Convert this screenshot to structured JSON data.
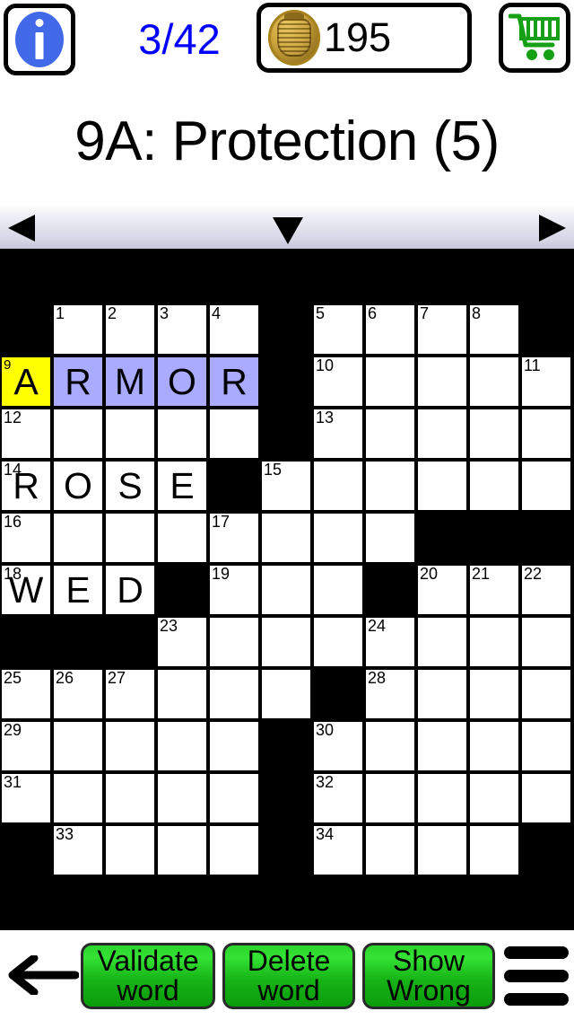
{
  "topbar": {
    "info_icon": "info-icon",
    "progress": "3/42",
    "coin_icon": "gold-coin-icon",
    "coin_count": "195",
    "cart_icon": "shopping-cart-icon"
  },
  "clue": {
    "text": "9A: Protection (5)"
  },
  "navstrip": {
    "prev_icon": "triangle-left-icon",
    "direction_icon": "triangle-down-icon",
    "next_icon": "triangle-right-icon"
  },
  "grid": {
    "columns": 11,
    "rows": 12,
    "cell_size": 58,
    "colors": {
      "block": "#000000",
      "empty": "#ffffff",
      "active_word": "#aaaaff",
      "cursor": "#ffff00"
    },
    "cells": [
      {
        "r": 1,
        "c": 1,
        "num": "1",
        "letter": ""
      },
      {
        "r": 1,
        "c": 2,
        "num": "2",
        "letter": ""
      },
      {
        "r": 1,
        "c": 3,
        "num": "3",
        "letter": ""
      },
      {
        "r": 1,
        "c": 4,
        "num": "4",
        "letter": ""
      },
      {
        "r": 1,
        "c": 6,
        "num": "5",
        "letter": ""
      },
      {
        "r": 1,
        "c": 7,
        "num": "6",
        "letter": ""
      },
      {
        "r": 1,
        "c": 8,
        "num": "7",
        "letter": ""
      },
      {
        "r": 1,
        "c": 9,
        "num": "8",
        "letter": ""
      },
      {
        "r": 2,
        "c": 0,
        "num": "9",
        "letter": "A",
        "state": "cursor"
      },
      {
        "r": 2,
        "c": 1,
        "num": "",
        "letter": "R",
        "state": "active"
      },
      {
        "r": 2,
        "c": 2,
        "num": "",
        "letter": "M",
        "state": "active"
      },
      {
        "r": 2,
        "c": 3,
        "num": "",
        "letter": "O",
        "state": "active"
      },
      {
        "r": 2,
        "c": 4,
        "num": "",
        "letter": "R",
        "state": "active"
      },
      {
        "r": 2,
        "c": 6,
        "num": "10",
        "letter": ""
      },
      {
        "r": 2,
        "c": 7,
        "num": "",
        "letter": ""
      },
      {
        "r": 2,
        "c": 8,
        "num": "",
        "letter": ""
      },
      {
        "r": 2,
        "c": 9,
        "num": "",
        "letter": ""
      },
      {
        "r": 2,
        "c": 10,
        "num": "11",
        "letter": ""
      },
      {
        "r": 3,
        "c": 0,
        "num": "12",
        "letter": ""
      },
      {
        "r": 3,
        "c": 1,
        "num": "",
        "letter": ""
      },
      {
        "r": 3,
        "c": 2,
        "num": "",
        "letter": ""
      },
      {
        "r": 3,
        "c": 3,
        "num": "",
        "letter": ""
      },
      {
        "r": 3,
        "c": 4,
        "num": "",
        "letter": ""
      },
      {
        "r": 3,
        "c": 6,
        "num": "13",
        "letter": ""
      },
      {
        "r": 3,
        "c": 7,
        "num": "",
        "letter": ""
      },
      {
        "r": 3,
        "c": 8,
        "num": "",
        "letter": ""
      },
      {
        "r": 3,
        "c": 9,
        "num": "",
        "letter": ""
      },
      {
        "r": 3,
        "c": 10,
        "num": "",
        "letter": ""
      },
      {
        "r": 4,
        "c": 0,
        "num": "14",
        "letter": "R"
      },
      {
        "r": 4,
        "c": 1,
        "num": "",
        "letter": "O"
      },
      {
        "r": 4,
        "c": 2,
        "num": "",
        "letter": "S"
      },
      {
        "r": 4,
        "c": 3,
        "num": "",
        "letter": "E"
      },
      {
        "r": 4,
        "c": 5,
        "num": "15",
        "letter": ""
      },
      {
        "r": 4,
        "c": 6,
        "num": "",
        "letter": ""
      },
      {
        "r": 4,
        "c": 7,
        "num": "",
        "letter": ""
      },
      {
        "r": 4,
        "c": 8,
        "num": "",
        "letter": ""
      },
      {
        "r": 4,
        "c": 9,
        "num": "",
        "letter": ""
      },
      {
        "r": 4,
        "c": 10,
        "num": "",
        "letter": ""
      },
      {
        "r": 5,
        "c": 0,
        "num": "16",
        "letter": ""
      },
      {
        "r": 5,
        "c": 1,
        "num": "",
        "letter": ""
      },
      {
        "r": 5,
        "c": 2,
        "num": "",
        "letter": ""
      },
      {
        "r": 5,
        "c": 3,
        "num": "",
        "letter": ""
      },
      {
        "r": 5,
        "c": 4,
        "num": "17",
        "letter": ""
      },
      {
        "r": 5,
        "c": 5,
        "num": "",
        "letter": ""
      },
      {
        "r": 5,
        "c": 6,
        "num": "",
        "letter": ""
      },
      {
        "r": 5,
        "c": 7,
        "num": "",
        "letter": ""
      },
      {
        "r": 6,
        "c": 0,
        "num": "18",
        "letter": "W"
      },
      {
        "r": 6,
        "c": 1,
        "num": "",
        "letter": "E"
      },
      {
        "r": 6,
        "c": 2,
        "num": "",
        "letter": "D"
      },
      {
        "r": 6,
        "c": 4,
        "num": "19",
        "letter": ""
      },
      {
        "r": 6,
        "c": 5,
        "num": "",
        "letter": ""
      },
      {
        "r": 6,
        "c": 6,
        "num": "",
        "letter": ""
      },
      {
        "r": 6,
        "c": 8,
        "num": "20",
        "letter": ""
      },
      {
        "r": 6,
        "c": 9,
        "num": "21",
        "letter": ""
      },
      {
        "r": 6,
        "c": 10,
        "num": "22",
        "letter": ""
      },
      {
        "r": 7,
        "c": 3,
        "num": "23",
        "letter": ""
      },
      {
        "r": 7,
        "c": 4,
        "num": "",
        "letter": ""
      },
      {
        "r": 7,
        "c": 5,
        "num": "",
        "letter": ""
      },
      {
        "r": 7,
        "c": 6,
        "num": "",
        "letter": ""
      },
      {
        "r": 7,
        "c": 7,
        "num": "24",
        "letter": ""
      },
      {
        "r": 7,
        "c": 8,
        "num": "",
        "letter": ""
      },
      {
        "r": 7,
        "c": 9,
        "num": "",
        "letter": ""
      },
      {
        "r": 7,
        "c": 10,
        "num": "",
        "letter": ""
      },
      {
        "r": 8,
        "c": 0,
        "num": "25",
        "letter": ""
      },
      {
        "r": 8,
        "c": 1,
        "num": "26",
        "letter": ""
      },
      {
        "r": 8,
        "c": 2,
        "num": "27",
        "letter": ""
      },
      {
        "r": 8,
        "c": 3,
        "num": "",
        "letter": ""
      },
      {
        "r": 8,
        "c": 4,
        "num": "",
        "letter": ""
      },
      {
        "r": 8,
        "c": 5,
        "num": "",
        "letter": ""
      },
      {
        "r": 8,
        "c": 7,
        "num": "28",
        "letter": ""
      },
      {
        "r": 8,
        "c": 8,
        "num": "",
        "letter": ""
      },
      {
        "r": 8,
        "c": 9,
        "num": "",
        "letter": ""
      },
      {
        "r": 8,
        "c": 10,
        "num": "",
        "letter": ""
      },
      {
        "r": 9,
        "c": 0,
        "num": "29",
        "letter": ""
      },
      {
        "r": 9,
        "c": 1,
        "num": "",
        "letter": ""
      },
      {
        "r": 9,
        "c": 2,
        "num": "",
        "letter": ""
      },
      {
        "r": 9,
        "c": 3,
        "num": "",
        "letter": ""
      },
      {
        "r": 9,
        "c": 4,
        "num": "",
        "letter": ""
      },
      {
        "r": 9,
        "c": 6,
        "num": "30",
        "letter": ""
      },
      {
        "r": 9,
        "c": 7,
        "num": "",
        "letter": ""
      },
      {
        "r": 9,
        "c": 8,
        "num": "",
        "letter": ""
      },
      {
        "r": 9,
        "c": 9,
        "num": "",
        "letter": ""
      },
      {
        "r": 9,
        "c": 10,
        "num": "",
        "letter": ""
      },
      {
        "r": 10,
        "c": 0,
        "num": "31",
        "letter": ""
      },
      {
        "r": 10,
        "c": 1,
        "num": "",
        "letter": ""
      },
      {
        "r": 10,
        "c": 2,
        "num": "",
        "letter": ""
      },
      {
        "r": 10,
        "c": 3,
        "num": "",
        "letter": ""
      },
      {
        "r": 10,
        "c": 4,
        "num": "",
        "letter": ""
      },
      {
        "r": 10,
        "c": 6,
        "num": "32",
        "letter": ""
      },
      {
        "r": 10,
        "c": 7,
        "num": "",
        "letter": ""
      },
      {
        "r": 10,
        "c": 8,
        "num": "",
        "letter": ""
      },
      {
        "r": 10,
        "c": 9,
        "num": "",
        "letter": ""
      },
      {
        "r": 10,
        "c": 10,
        "num": "",
        "letter": ""
      },
      {
        "r": 11,
        "c": 1,
        "num": "33",
        "letter": ""
      },
      {
        "r": 11,
        "c": 2,
        "num": "",
        "letter": ""
      },
      {
        "r": 11,
        "c": 3,
        "num": "",
        "letter": ""
      },
      {
        "r": 11,
        "c": 4,
        "num": "",
        "letter": ""
      },
      {
        "r": 11,
        "c": 6,
        "num": "34",
        "letter": ""
      },
      {
        "r": 11,
        "c": 7,
        "num": "",
        "letter": ""
      },
      {
        "r": 11,
        "c": 8,
        "num": "",
        "letter": ""
      },
      {
        "r": 11,
        "c": 9,
        "num": "",
        "letter": ""
      }
    ]
  },
  "bottombar": {
    "back_icon": "back-arrow-icon",
    "validate_line1": "Validate",
    "validate_line2": "word",
    "delete_line1": "Delete",
    "delete_line2": "word",
    "show_line1": "Show",
    "show_line2": "Wrong",
    "menu_icon": "hamburger-menu-icon",
    "button_color": "#22c322"
  }
}
